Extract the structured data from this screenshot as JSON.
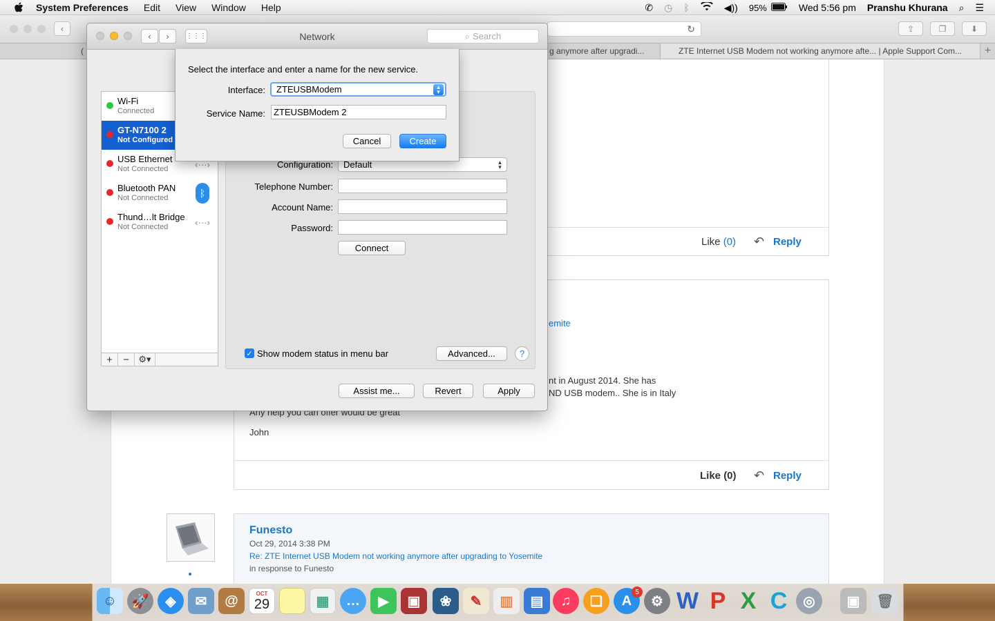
{
  "menubar": {
    "app_name": "System Preferences",
    "items": [
      "Edit",
      "View",
      "Window",
      "Help"
    ],
    "battery": "95%",
    "datetime": "Wed 5:56 pm",
    "user": "Pranshu Khurana"
  },
  "safari": {
    "tabs": [
      {
        "label": "g anymore after upgradi..."
      },
      {
        "label": "ZTE Internet USB Modem not working anymore afte... | Apple Support Com..."
      }
    ],
    "left_tab_stub": "("
  },
  "page": {
    "post1": {
      "like_label": "Like",
      "like_count": "(0)",
      "reply_label": "Reply"
    },
    "post2": {
      "link_fragment": "emite",
      "body_line1": "nt in August 2014. She has",
      "body_line2": "ND USB modem.. She is in Italy",
      "body_line3": "Any help you can offer would be great",
      "signature": "John",
      "like_label": "Like",
      "like_count": "(0)",
      "reply_label": "Reply"
    },
    "post3": {
      "author": "Funesto",
      "date": "Oct 29, 2014 3:38 PM",
      "subject": "Re: ZTE Internet USB Modem not working anymore after upgrading to Yosemite",
      "in_response": "in response to Funesto"
    }
  },
  "prefs": {
    "title": "Network",
    "search_placeholder": "Search",
    "services": [
      {
        "name": "Wi-Fi",
        "status": "Connected",
        "color": "#2bc840"
      },
      {
        "name": "GT-N7100 2",
        "status": "Not Configured",
        "color": "#e8262b"
      },
      {
        "name": "USB Ethernet",
        "status": "Not Connected",
        "color": "#e8262b"
      },
      {
        "name": "Bluetooth PAN",
        "status": "Not Connected",
        "color": "#e8262b"
      },
      {
        "name": "Thund…lt Bridge",
        "status": "Not Connected",
        "color": "#e8262b"
      }
    ],
    "configuration_label": "Configuration:",
    "configuration_value": "Default",
    "telephone_label": "Telephone Number:",
    "account_label": "Account Name:",
    "password_label": "Password:",
    "connect_label": "Connect",
    "show_modem_label": "Show modem status in menu bar",
    "advanced_label": "Advanced...",
    "help_label": "?",
    "assist_label": "Assist me...",
    "revert_label": "Revert",
    "apply_label": "Apply"
  },
  "sheet": {
    "prompt": "Select the interface and enter a name for the new service.",
    "interface_label": "Interface:",
    "interface_value": "ZTEUSBModem",
    "service_label": "Service Name:",
    "service_value": "ZTEUSBModem 2",
    "cancel_label": "Cancel",
    "create_label": "Create"
  },
  "dock": {
    "calendar_month": "OCT",
    "calendar_day": "29",
    "appstore_badge": "5"
  }
}
